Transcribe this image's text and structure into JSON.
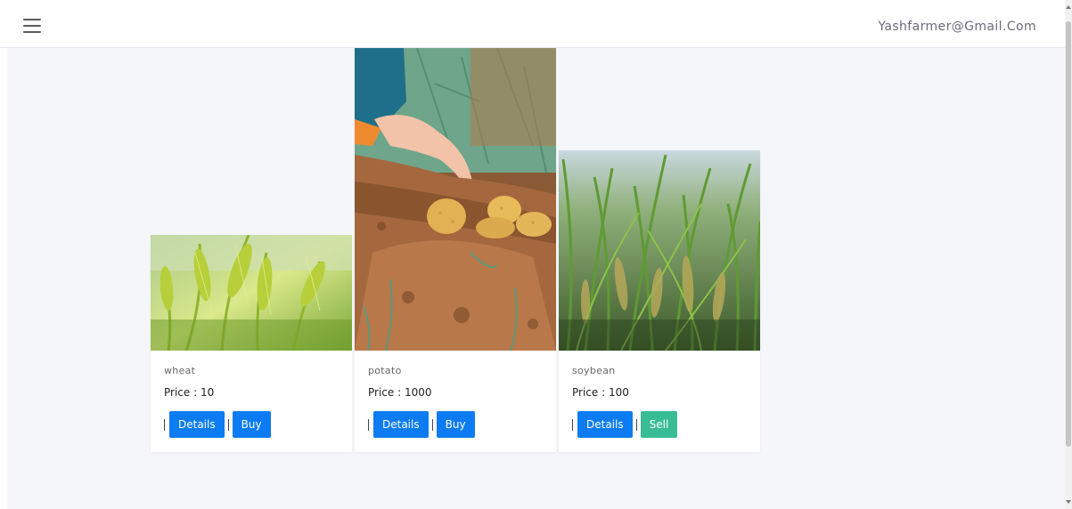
{
  "header": {
    "user_email": "Yashfarmer@Gmail.Com"
  },
  "cards": [
    {
      "name": "wheat",
      "price": "Price : 10",
      "details_label": "Details",
      "action_label": "Buy"
    },
    {
      "name": "potato",
      "price": "Price : 1000",
      "details_label": "Details",
      "action_label": "Buy"
    },
    {
      "name": "soybean",
      "price": "Price : 100",
      "details_label": "Details",
      "action_label": "Sell"
    }
  ],
  "icons": {
    "menu": "hamburger-menu-icon"
  },
  "colors": {
    "primary_button": "#0d7cf2",
    "sell_button": "#38bc93",
    "page_background": "#f5f6fa"
  }
}
